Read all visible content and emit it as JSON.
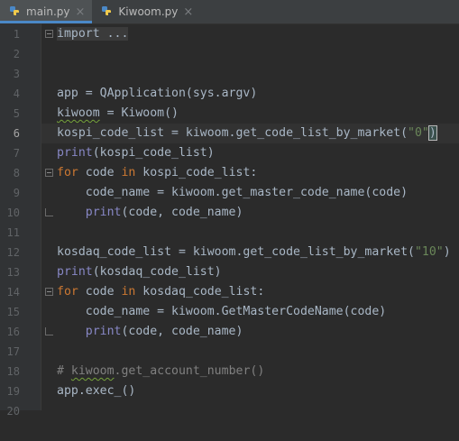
{
  "tabs": [
    {
      "label": "main.py",
      "active": true,
      "icon": "python-file-icon"
    },
    {
      "label": "Kiwoom.py",
      "active": false,
      "icon": "python-file-icon"
    }
  ],
  "close_glyph": "×",
  "current_line": 6,
  "line_numbers": [
    "1",
    "2",
    "3",
    "4",
    "5",
    "6",
    "7",
    "8",
    "9",
    "10",
    "11",
    "12",
    "13",
    "14",
    "15",
    "16",
    "17",
    "18",
    "19",
    "20"
  ],
  "code": {
    "l1": "import ...",
    "l4": "app = QApplication(sys.argv)",
    "l5_a": "kiwoom",
    "l5_b": " = Kiwoom()",
    "l6_a": "kospi_code_list = kiwoom.get_code_list_by_market(",
    "l6_b": "\"0\"",
    "l6_c": ")",
    "l7_a": "print",
    "l7_b": "(kospi_code_list)",
    "l8_a": "for",
    "l8_b": " code ",
    "l8_c": "in",
    "l8_d": " kospi_code_list:",
    "l9": "    code_name = kiwoom.get_master_code_name(code)",
    "l10_a": "    ",
    "l10_b": "print",
    "l10_c": "(code, code_name)",
    "l12_a": "kosdaq_code_list = kiwoom.get_code_list_by_market(",
    "l12_b": "\"10\"",
    "l12_c": ")",
    "l13_a": "print",
    "l13_b": "(kosdaq_code_list)",
    "l14_a": "for",
    "l14_b": " code ",
    "l14_c": "in",
    "l14_d": " kosdaq_code_list:",
    "l15": "    code_name = kiwoom.GetMasterCodeName(code)",
    "l16_a": "    ",
    "l16_b": "print",
    "l16_c": "(code, code_name)",
    "l18_a": "# ",
    "l18_b": "kiwoom",
    "l18_c": ".get_account_number()",
    "l19": "app.exec_()"
  },
  "colors": {
    "background": "#2b2b2b",
    "keyword": "#cc7832",
    "string": "#6a8759",
    "builtin": "#8888c6",
    "comment": "#808080"
  }
}
